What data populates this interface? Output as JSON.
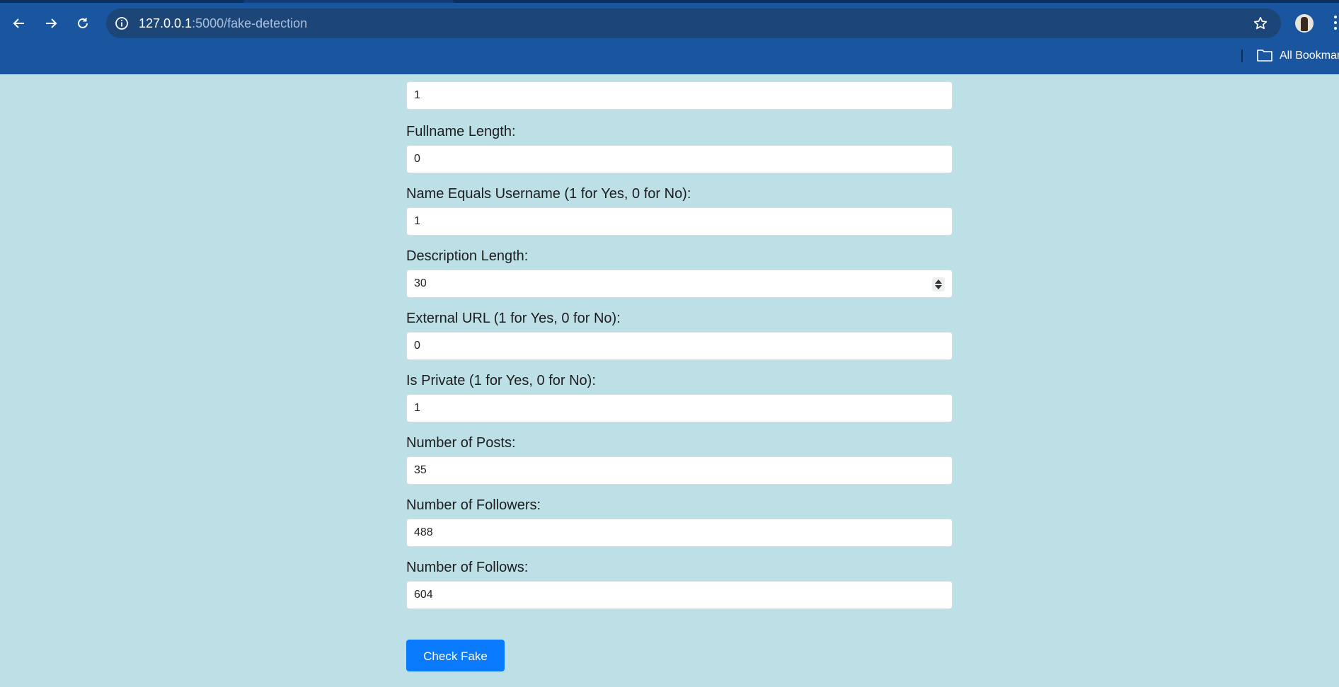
{
  "browser": {
    "url_host": "127.0.0.1",
    "url_path": ":5000/fake-detection",
    "bookmarks_label": "All Bookmarks"
  },
  "form": {
    "top_field": {
      "value": "1"
    },
    "fields": [
      {
        "label": "Fullname Length:",
        "value": "0"
      },
      {
        "label": "Name Equals Username (1 for Yes, 0 for No):",
        "value": "1"
      },
      {
        "label": "Description Length:",
        "value": "30"
      },
      {
        "label": "External URL (1 for Yes, 0 for No):",
        "value": "0"
      },
      {
        "label": "Is Private (1 for Yes, 0 for No):",
        "value": "1"
      },
      {
        "label": "Number of Posts:",
        "value": "35"
      },
      {
        "label": "Number of Followers:",
        "value": "488"
      },
      {
        "label": "Number of Follows:",
        "value": "604"
      }
    ],
    "submit_label": "Check Fake"
  },
  "colors": {
    "chrome_bg": "#1a55a0",
    "page_bg": "#bde0e6",
    "button_bg": "#0a7bff"
  }
}
